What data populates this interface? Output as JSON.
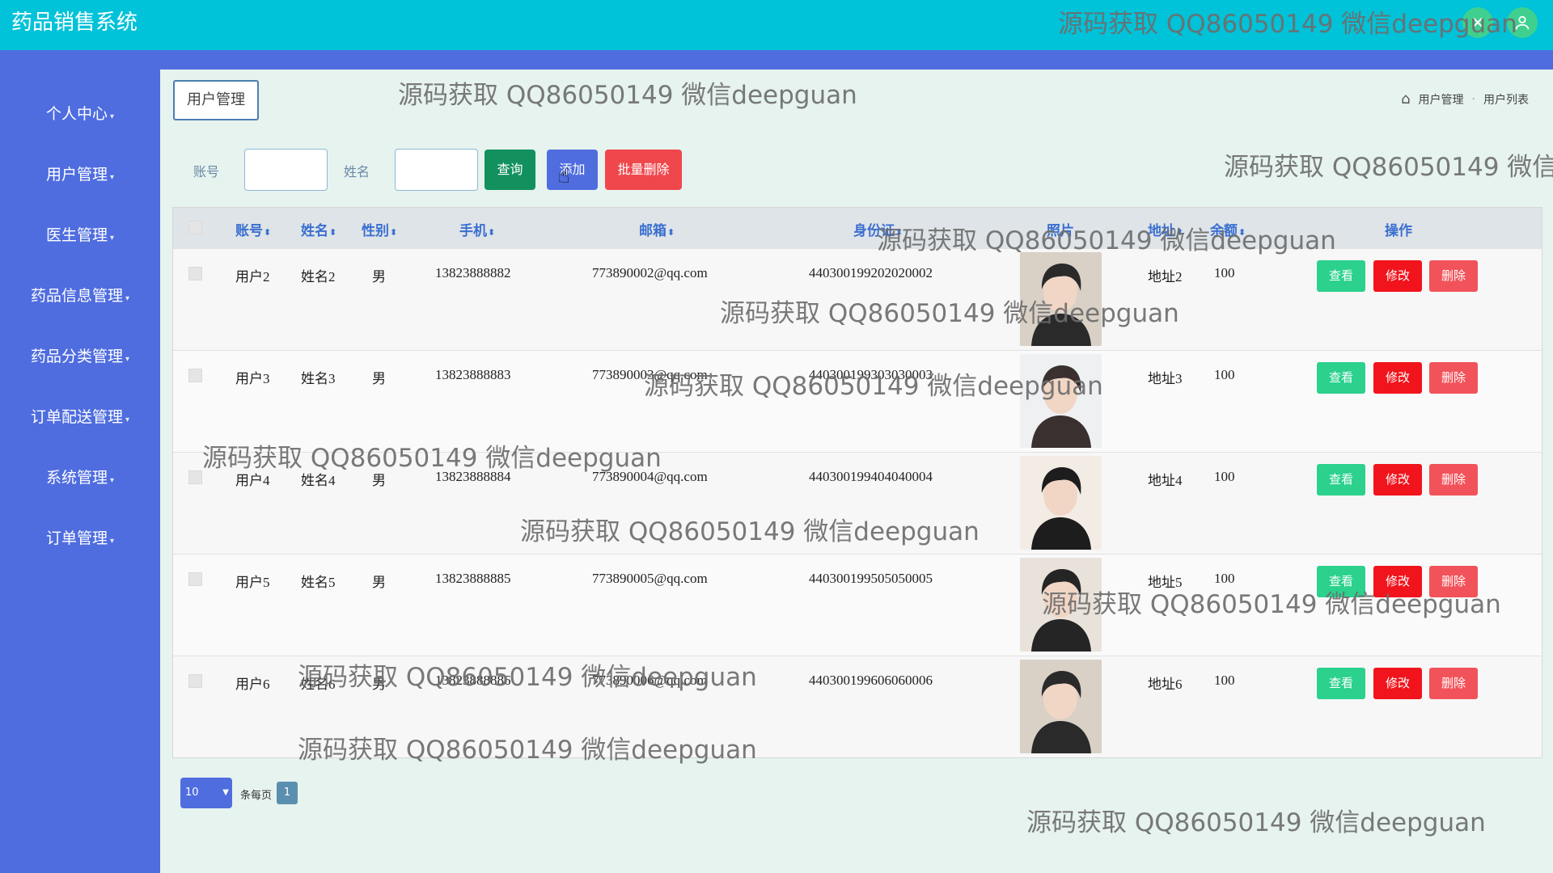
{
  "app": {
    "title": "药品销售系统"
  },
  "sidebar": {
    "items": [
      {
        "label": "个人中心"
      },
      {
        "label": "用户管理"
      },
      {
        "label": "医生管理"
      },
      {
        "label": "药品信息管理"
      },
      {
        "label": "药品分类管理"
      },
      {
        "label": "订单配送管理"
      },
      {
        "label": "系统管理"
      },
      {
        "label": "订单管理"
      }
    ],
    "caret": "▾"
  },
  "page": {
    "tab_title": "用户管理",
    "breadcrumb": [
      "用户管理",
      "用户列表"
    ]
  },
  "search": {
    "account_label": "账号",
    "name_label": "姓名",
    "account_value": "",
    "name_value": "",
    "search_button": "查询",
    "add_button": "添加",
    "batch_delete_button": "批量删除"
  },
  "table": {
    "headers": [
      "账号",
      "姓名",
      "性别",
      "手机",
      "邮箱",
      "身份证",
      "照片",
      "地址",
      "余额",
      "操作"
    ],
    "sort_glyph": "⬍",
    "actions": {
      "view": "查看",
      "edit": "修改",
      "delete": "删除"
    },
    "rows": [
      {
        "account": "用户2",
        "name": "姓名2",
        "gender": "男",
        "phone": "13823888882",
        "email": "773890002@qq.com",
        "id_card": "440300199202020002",
        "address": "地址2",
        "balance": "100"
      },
      {
        "account": "用户3",
        "name": "姓名3",
        "gender": "男",
        "phone": "13823888883",
        "email": "773890003@qq.com",
        "id_card": "440300199303030003",
        "address": "地址3",
        "balance": "100"
      },
      {
        "account": "用户4",
        "name": "姓名4",
        "gender": "男",
        "phone": "13823888884",
        "email": "773890004@qq.com",
        "id_card": "440300199404040004",
        "address": "地址4",
        "balance": "100"
      },
      {
        "account": "用户5",
        "name": "姓名5",
        "gender": "男",
        "phone": "13823888885",
        "email": "773890005@qq.com",
        "id_card": "440300199505050005",
        "address": "地址5",
        "balance": "100"
      },
      {
        "account": "用户6",
        "name": "姓名6",
        "gender": "男",
        "phone": "13823888886",
        "email": "773890006@qq.com",
        "id_card": "440300199606060006",
        "address": "地址6",
        "balance": "100"
      }
    ]
  },
  "pagination": {
    "page_size": "10",
    "per_page_label": "条每页",
    "current_page": "1"
  },
  "watermark": {
    "text": "源码获取 QQ86050149 微信deepguan"
  },
  "colors": {
    "topbar": "#00c2d8",
    "sidebar": "#4f6ddf",
    "view": "#2bd18d",
    "edit": "#f1141c",
    "delete": "#f2535a"
  }
}
